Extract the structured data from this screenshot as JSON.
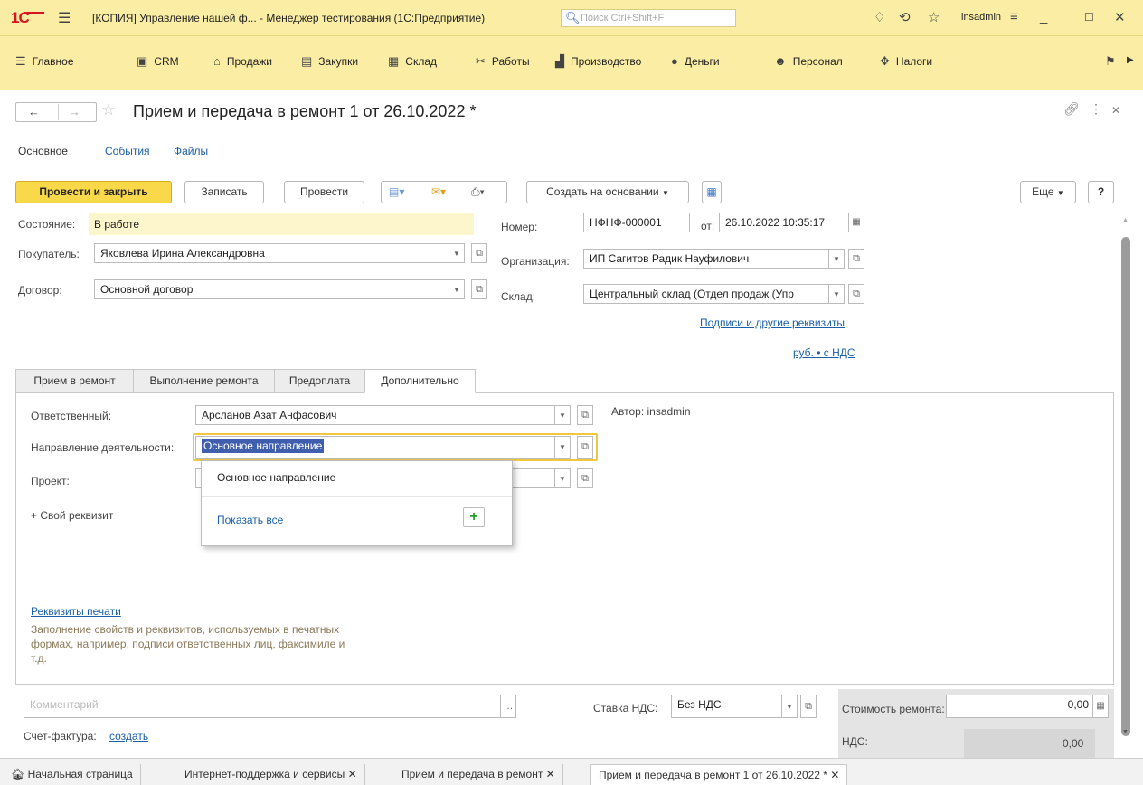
{
  "titlebar": {
    "logo": "1С",
    "title": "[КОПИЯ] Управление нашей ф...  - Менеджер тестирования (1С:Предприятие)",
    "search_placeholder": "Поиск Ctrl+Shift+F",
    "user": "insadmin"
  },
  "sections": [
    "Главное",
    "CRM",
    "Продажи",
    "Закупки",
    "Склад",
    "Работы",
    "Производство",
    "Деньги",
    "Персонал",
    "Налоги"
  ],
  "form": {
    "title": "Прием и передача в ремонт 1 от 26.10.2022 *",
    "tabs": [
      "Основное",
      "События",
      "Файлы"
    ]
  },
  "toolbar": {
    "post_close": "Провести и закрыть",
    "save": "Записать",
    "post": "Провести",
    "create_based": "Создать на основании",
    "more": "Еще",
    "help": "?"
  },
  "fields": {
    "state_label": "Состояние:",
    "state_value": "В работе",
    "number_label": "Номер:",
    "number_value": "НФНФ-000001",
    "date_label": "от:",
    "date_value": "26.10.2022 10:35:17",
    "buyer_label": "Покупатель:",
    "buyer_value": "Яковлева Ирина Александровна",
    "org_label": "Организация:",
    "org_value": "ИП Сагитов Радик Науфилович",
    "contract_label": "Договор:",
    "contract_value": "Основной договор",
    "warehouse_label": "Склад:",
    "warehouse_value": "Центральный склад (Отдел продаж (Упр",
    "signatures_link": "Подписи и другие реквизиты",
    "currency_link": "руб. • с НДС"
  },
  "tabs": [
    "Прием в ремонт",
    "Выполнение ремонта",
    "Предоплата",
    "Дополнительно"
  ],
  "additional": {
    "responsible_label": "Ответственный:",
    "responsible_value": "Арсланов Азат Анфасович",
    "author": "Автор: insadmin",
    "direction_label": "Направление деятельности:",
    "direction_value": "Основное направление",
    "project_label": "Проект:",
    "custom_attr": "+ Свой реквизит",
    "print_link": "Реквизиты печати",
    "print_note_1": "Заполнение свойств и реквизитов, используемых в печатных",
    "print_note_2": "формах, например, подписи ответственных лиц, факсимиле и",
    "print_note_3": "т.д."
  },
  "popup": {
    "item": "Основное направление",
    "show_all": "Показать все"
  },
  "footer": {
    "comment_placeholder": "Комментарий",
    "vat_rate_label": "Ставка НДС:",
    "vat_rate_value": "Без НДС",
    "repair_cost_label": "Стоимость ремонта:",
    "repair_cost_value": "0,00",
    "vat_label": "НДС:",
    "vat_value": "0,00",
    "invoice_label": "Счет-фактура:",
    "invoice_link": "создать"
  },
  "taskbar": [
    "Начальная страница",
    "Интернет-поддержка и сервисы",
    "Прием и передача в ремонт",
    "Прием и передача в ремонт 1 от 26.10.2022 *"
  ],
  "colors": {
    "panel_yellow": "#fbeea4",
    "primary_button": "#f9d94a",
    "link": "#1a5fa8",
    "brand_red": "#d8141c"
  }
}
